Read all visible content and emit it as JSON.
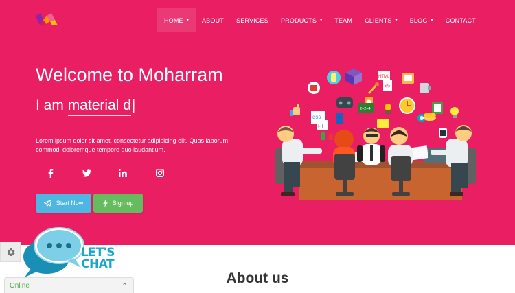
{
  "nav": {
    "items": [
      {
        "label": "HOME",
        "active": true,
        "dropdown": true
      },
      {
        "label": "ABOUT",
        "active": false,
        "dropdown": false
      },
      {
        "label": "SERVICES",
        "active": false,
        "dropdown": false
      },
      {
        "label": "PRODUCTS",
        "active": false,
        "dropdown": true
      },
      {
        "label": "TEAM",
        "active": false,
        "dropdown": false
      },
      {
        "label": "CLIENTS",
        "active": false,
        "dropdown": true
      },
      {
        "label": "BLOG",
        "active": false,
        "dropdown": true
      },
      {
        "label": "CONTACT",
        "active": false,
        "dropdown": false
      }
    ],
    "caret": "▾"
  },
  "hero": {
    "title": "Welcome to Moharram",
    "typed_prefix": "I am ",
    "typed_word": "material d",
    "typed_cursor": "|",
    "description": "Lorem ipsum dolor sit amet, consectetur adipisicing elit. Quas laborum commodi doloremque tempore quo laudantium.",
    "social": [
      "facebook-icon",
      "twitter-icon",
      "linkedin-icon",
      "instagram-icon"
    ],
    "start_label": "Start Now",
    "signup_label": "Sign up"
  },
  "about": {
    "heading": "About us"
  },
  "chat": {
    "lets": "LET'S",
    "chat": "CHAT",
    "status": "Online",
    "toggle": "⌃"
  },
  "colors": {
    "primary": "#e91e63",
    "start_button": "#4fb5e1",
    "signup_button": "#66bb5f",
    "chat_accent": "#1aa6c8",
    "online": "#4caf50"
  }
}
